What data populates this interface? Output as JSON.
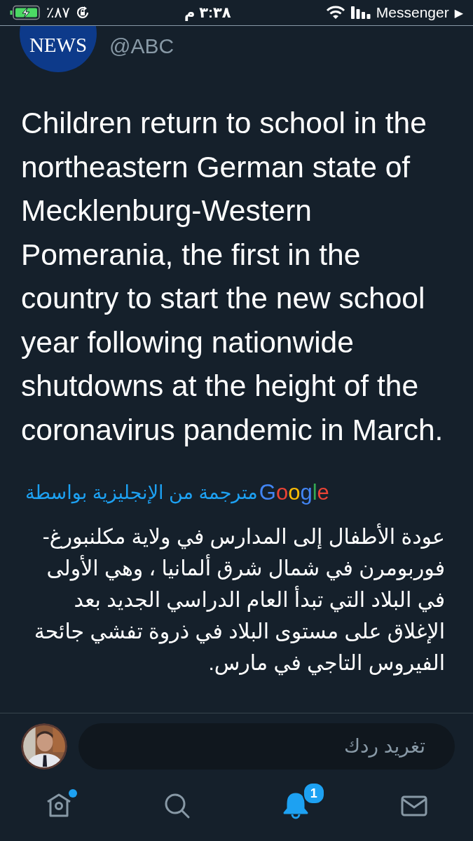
{
  "status_bar": {
    "battery_percent": "٪٨٧",
    "time": "٣:٣٨ م",
    "back_app": "Messenger",
    "back_arrow": "▶"
  },
  "tweet": {
    "avatar_text": "NEWS",
    "handle": "@ABC",
    "text": "Children return to school in the northeastern German state of Mecklenburg-Western Pomerania, the first in the country to start the new school year following nationwide shutdowns at the height of the coronavirus pandemic in March.",
    "translation_label": "مترجمة من الإنجليزية بواسطة",
    "translation_logo": "Google",
    "translated_text": "عودة الأطفال إلى المدارس في ولاية مكلنبورغ- فوربومرن في شمال شرق ألمانيا ، وهي الأولى في البلاد التي تبدأ العام الدراسي الجديد بعد الإغلاق على مستوى البلاد في ذروة تفشي جائحة الفيروس التاجي في مارس."
  },
  "reply": {
    "placeholder": "تغريد ردك"
  },
  "tab_bar": [
    {
      "kind": "home",
      "selected": false,
      "dot": true
    },
    {
      "kind": "search",
      "selected": false,
      "dot": false
    },
    {
      "kind": "notifications",
      "selected": true,
      "dot": false,
      "badge": "1"
    },
    {
      "kind": "messages",
      "selected": false,
      "dot": false
    }
  ]
}
